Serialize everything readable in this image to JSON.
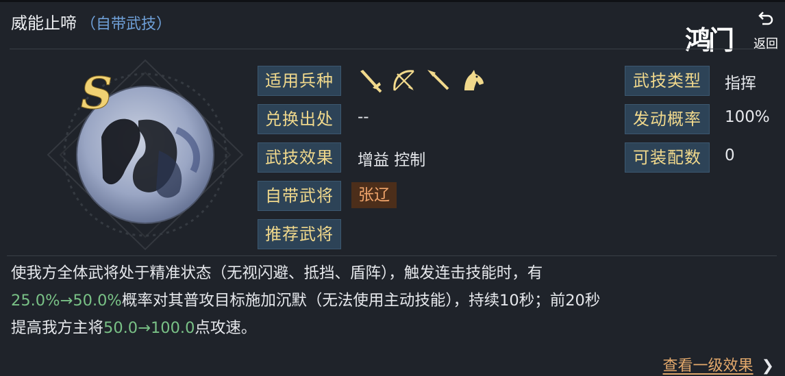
{
  "header": {
    "title": "威能止啼",
    "subtitle": "（自带武技）"
  },
  "logo": {
    "text": "鸿门",
    "back_label": "返回"
  },
  "skill": {
    "rank": "S",
    "unit_icons": [
      "sword-icon",
      "bow-icon",
      "spear-icon",
      "horse-icon"
    ],
    "rows": [
      {
        "label": "适用兵种",
        "value": ""
      },
      {
        "label": "兑换出处",
        "value": "--"
      },
      {
        "label": "武技效果",
        "value": "增益 控制"
      },
      {
        "label": "自带武将",
        "value": "张辽"
      },
      {
        "label": "推荐武将",
        "value": ""
      }
    ],
    "right_rows": [
      {
        "label": "武技类型",
        "value": "指挥"
      },
      {
        "label": "发动概率",
        "value": "100%"
      },
      {
        "label": "可装配数",
        "value": "0"
      }
    ]
  },
  "description": {
    "line1": "使我方全体武将处于精准状态（无视闪避、抵挡、盾阵），触发连击技能时，有",
    "line2_highlight": "25.0%→50.0%",
    "line2_rest": "概率对其普攻目标施加沉默（无法使用主动技能），持续10秒；前20秒",
    "line3_pre": "提高我方主将",
    "line3_highlight": "50.0→100.0",
    "line3_post": "点攻速。"
  },
  "footer": {
    "link_label": "查看一级效果",
    "chevron": "❯"
  },
  "colors": {
    "background": "#1f232a",
    "label_bg": "#2d4357",
    "label_text": "#f1d98c",
    "highlight_green": "#79c186",
    "general_chip_bg": "#4c2e1a",
    "general_chip_text": "#f1a56b",
    "link_color": "#e3a96c",
    "subtitle_blue": "#6fa0d8"
  }
}
